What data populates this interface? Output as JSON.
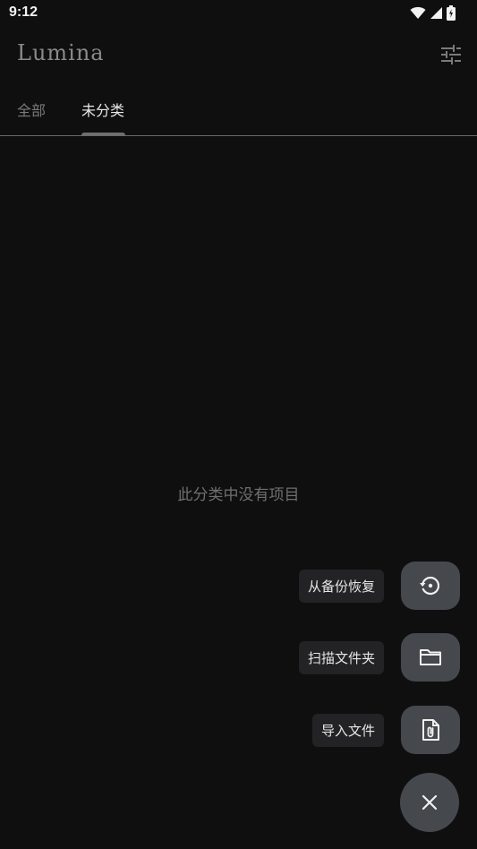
{
  "status_bar": {
    "time": "9:12",
    "icons": [
      "wifi-icon",
      "signal-icon",
      "battery-icon"
    ]
  },
  "app_bar": {
    "title": "Lumina",
    "filter_icon": "tune-icon"
  },
  "tabs": [
    {
      "label": "全部",
      "selected": false
    },
    {
      "label": "未分类",
      "selected": true
    }
  ],
  "empty_state": {
    "message": "此分类中没有项目"
  },
  "fab_menu": {
    "actions": [
      {
        "label": "从备份恢复",
        "icon": "restore-icon"
      },
      {
        "label": "扫描文件夹",
        "icon": "folder-icon"
      },
      {
        "label": "导入文件",
        "icon": "file-attach-icon"
      }
    ],
    "close_icon": "close-icon"
  },
  "colors": {
    "background": "#0f0f10",
    "fab": "#45484d",
    "label_bg": "#232325"
  }
}
